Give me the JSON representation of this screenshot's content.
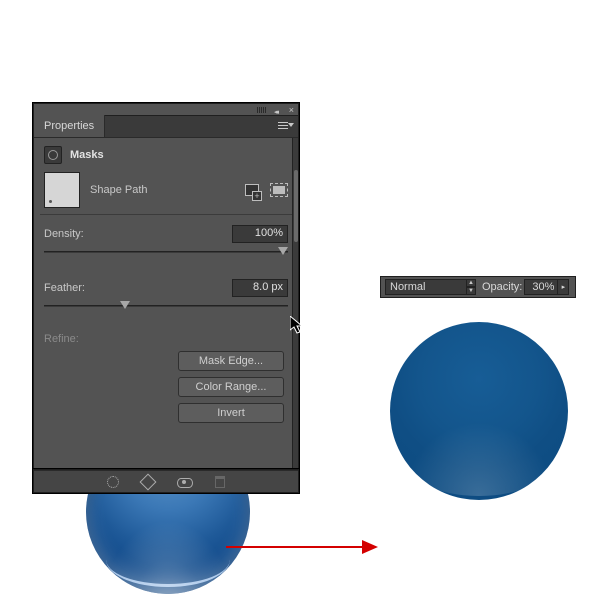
{
  "panel": {
    "tab": "Properties",
    "section_title": "Masks",
    "thumb_label": "Shape Path",
    "density": {
      "label": "Density:",
      "value": "100%"
    },
    "feather": {
      "label": "Feather:",
      "value": "8.0 px"
    },
    "refine_label": "Refine:",
    "buttons": {
      "mask_edge": "Mask Edge...",
      "color_range": "Color Range...",
      "invert": "Invert"
    }
  },
  "toolbar": {
    "blend_mode": "Normal",
    "opacity_label": "Opacity:",
    "opacity_value": "30%"
  },
  "icons": {
    "collapse": "collapse-panel-icon",
    "close": "close-icon",
    "panel_menu": "panel-menu-icon",
    "add_mask": "add-mask-icon",
    "select_mask": "select-pixel-mask-icon",
    "load_selection": "load-selection-icon",
    "apply_mask": "apply-mask-icon",
    "toggle_mask": "toggle-mask-visibility-icon",
    "delete_mask": "delete-mask-icon"
  },
  "colors": {
    "panel_bg": "#535353",
    "accent_blue": "#0f4e84",
    "arrow": "#d40000"
  }
}
